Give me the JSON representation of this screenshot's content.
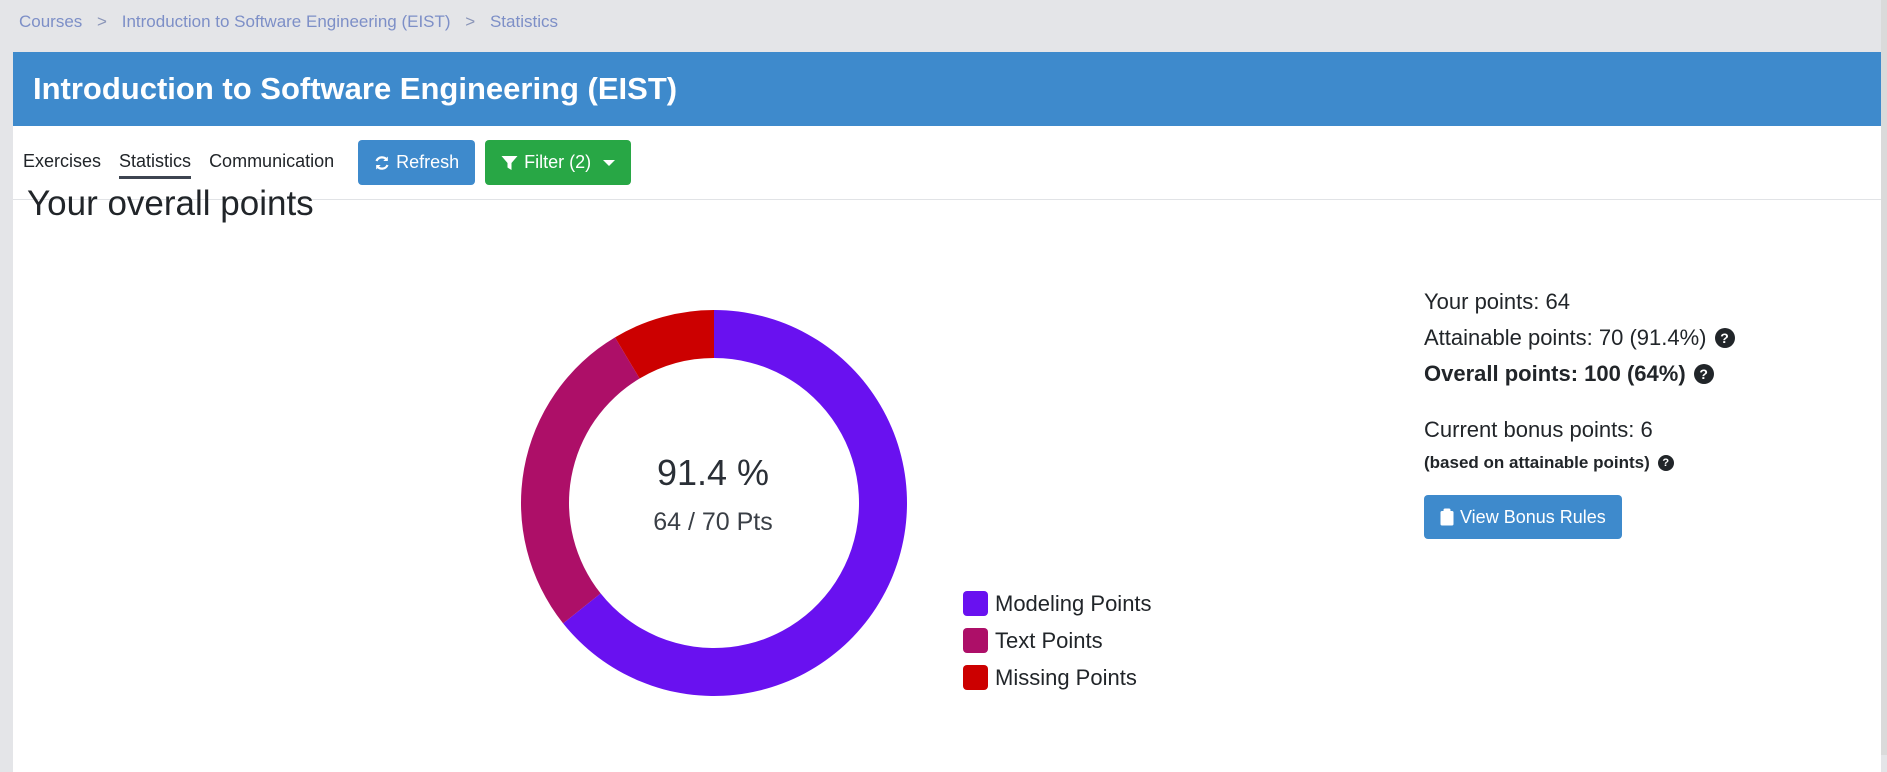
{
  "breadcrumb": [
    "Courses",
    "Introduction to Software Engineering (EIST)",
    "Statistics"
  ],
  "breadcrumb_separator": ">",
  "header": {
    "title": "Introduction to Software Engineering (EIST)"
  },
  "nav": {
    "tabs": [
      {
        "label": "Exercises",
        "active": false
      },
      {
        "label": "Statistics",
        "active": true
      },
      {
        "label": "Communication",
        "active": false
      }
    ],
    "refresh_label": "Refresh",
    "filter_label": "Filter (2)"
  },
  "section_title": "Your overall points",
  "donut_center": {
    "percent": "91.4 %",
    "points": "64 / 70 Pts"
  },
  "stats": {
    "your_points": "Your points: 64",
    "attainable_points": "Attainable points: 70 (91.4%)",
    "overall_points": "Overall points: 100 (64%)",
    "current_bonus": "Current bonus points: 6",
    "bonus_basis": "(based on attainable points)",
    "view_bonus_rules": "View Bonus Rules",
    "help_glyph": "?"
  },
  "chart_data": {
    "type": "pie",
    "variant": "doughnut",
    "title": "Your overall points",
    "categories": [
      "Modeling Points",
      "Text Points",
      "Missing Points"
    ],
    "values": [
      45,
      19,
      6
    ],
    "colors": [
      "#6911f0",
      "#ad0f68",
      "#cc0000"
    ],
    "total": 70,
    "center_label": "91.4 %",
    "center_sublabel": "64 / 70 Pts",
    "legend": "right-bottom"
  }
}
